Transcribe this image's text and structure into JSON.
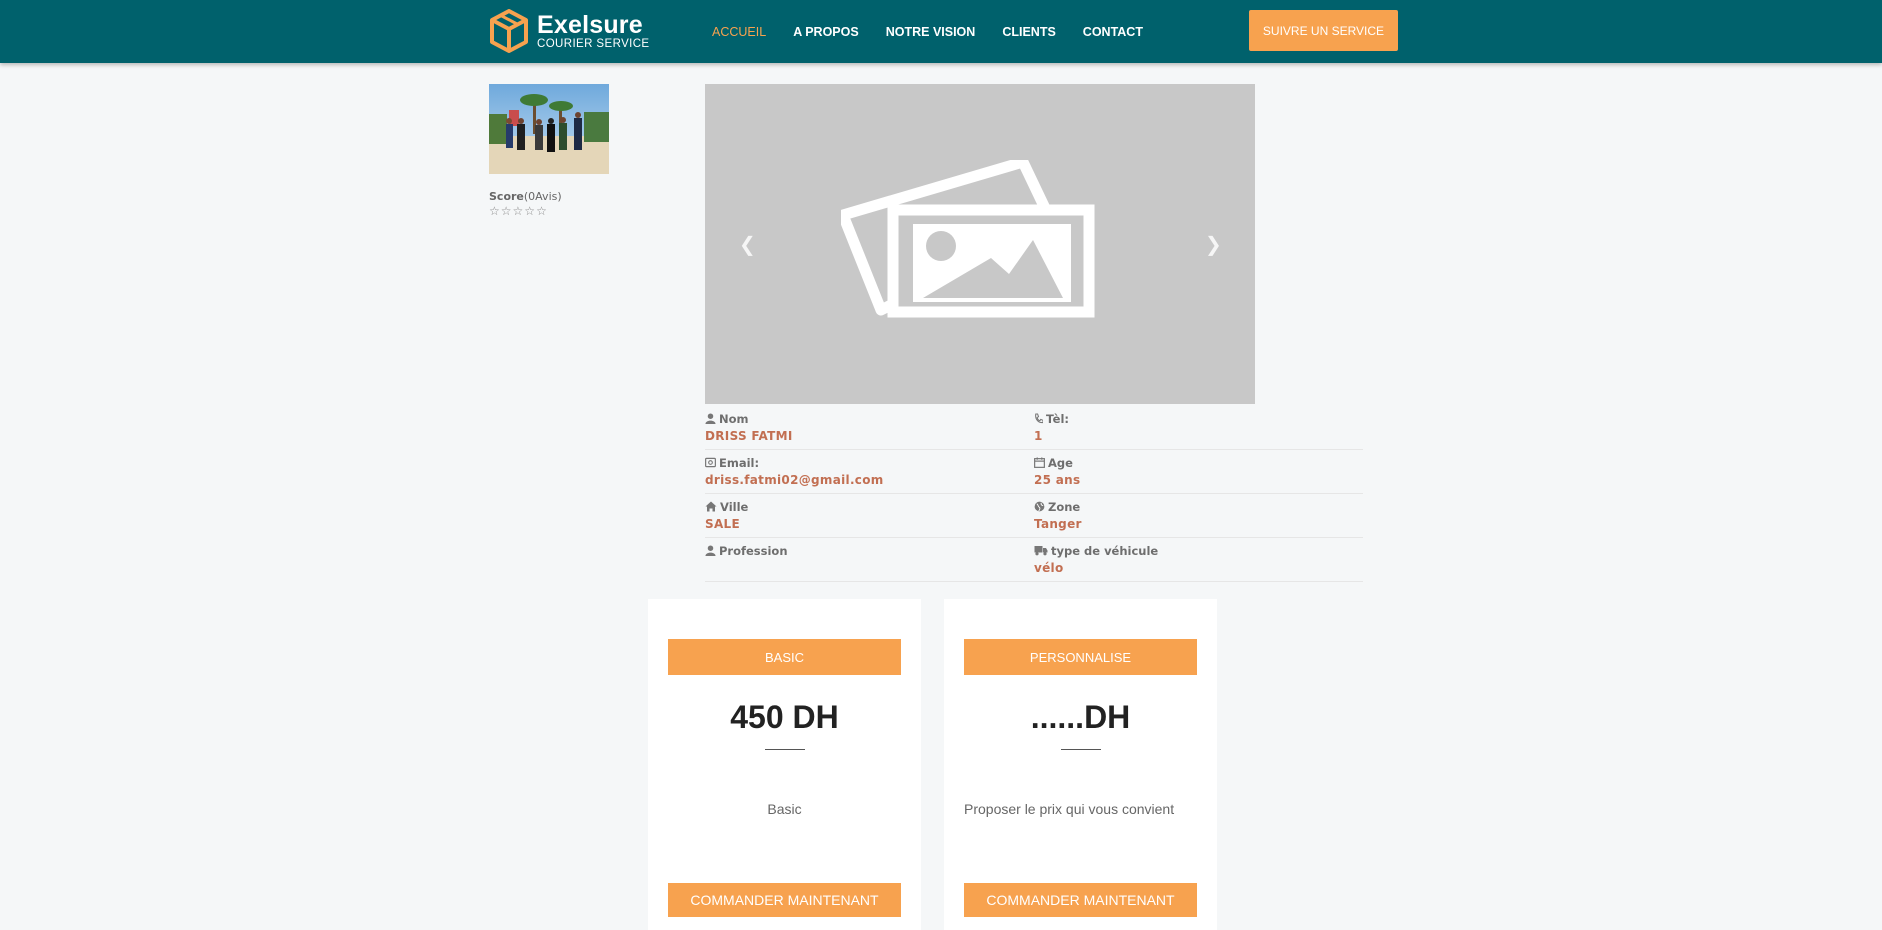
{
  "brand": {
    "name": "Exelsure",
    "tagline": "COURIER SERVICE",
    "accent": "#f7a24f",
    "header_bg": "#00616c"
  },
  "nav": {
    "items": [
      {
        "label": "ACCUEIL",
        "active": true
      },
      {
        "label": "A PROPOS"
      },
      {
        "label": "NOTRE VISION"
      },
      {
        "label": "CLIENTS"
      },
      {
        "label": "CONTACT"
      }
    ],
    "cta": "SUIVRE UN SERVICE"
  },
  "profile": {
    "score_label": "Score",
    "score_count": "(0Avis)",
    "stars": 0,
    "max_stars": 5
  },
  "carousel": {
    "prev_icon": "chevron-left-icon",
    "next_icon": "chevron-right-icon"
  },
  "details": {
    "nom": {
      "label": "Nom",
      "value": "DRISS FATMI"
    },
    "tel": {
      "label": "Tèl:",
      "value": "1"
    },
    "email": {
      "label": "Email:",
      "value": "driss.fatmi02@gmail.com"
    },
    "age": {
      "label": "Age",
      "value": "25 ans"
    },
    "ville": {
      "label": "Ville",
      "value": "SALE"
    },
    "zone": {
      "label": "Zone",
      "value": "Tanger"
    },
    "profession": {
      "label": "Profession",
      "value": ""
    },
    "vehicule": {
      "label": "type de véhicule",
      "value": "vélo"
    }
  },
  "plans": [
    {
      "name": "BASIC",
      "price": "450 DH",
      "description": "Basic",
      "button": "COMMANDER MAINTENANT"
    },
    {
      "name": "PERSONNALISE",
      "price": "......DH",
      "description": "Proposer le prix qui vous convient",
      "button": "COMMANDER MAINTENANT"
    }
  ]
}
